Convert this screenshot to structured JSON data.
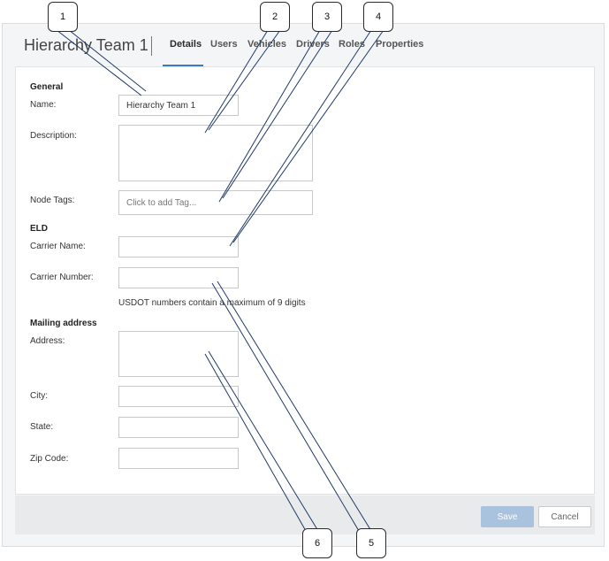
{
  "header": {
    "title": "Hierarchy Team 1",
    "tabs": [
      {
        "label": "Details",
        "active": true
      },
      {
        "label": "Users",
        "active": false
      },
      {
        "label": "Vehicles",
        "active": false
      },
      {
        "label": "Drivers",
        "active": false
      },
      {
        "label": "Roles",
        "active": false
      },
      {
        "label": "Properties",
        "active": false
      }
    ]
  },
  "general": {
    "section_label": "General",
    "name_label": "Name:",
    "name_value": "Hierarchy Team 1",
    "description_label": "Description:",
    "description_value": "",
    "node_tags_label": "Node Tags:",
    "node_tags_placeholder": "Click to add Tag..."
  },
  "eld": {
    "section_label": "ELD",
    "carrier_name_label": "Carrier Name:",
    "carrier_name_value": "",
    "carrier_number_label": "Carrier Number:",
    "carrier_number_value": "",
    "hint": "USDOT numbers contain a maximum of 9 digits"
  },
  "mailing": {
    "section_label": "Mailing address",
    "address_label": "Address:",
    "address_value": "",
    "city_label": "City:",
    "city_value": "",
    "state_label": "State:",
    "state_value": "",
    "zip_label": "Zip Code:",
    "zip_value": ""
  },
  "footer": {
    "save_label": "Save",
    "cancel_label": "Cancel"
  },
  "callouts": [
    "1",
    "2",
    "3",
    "4",
    "5",
    "6"
  ],
  "colors": {
    "accent": "#3b7bbf",
    "save_disabled": "#a9c3de"
  }
}
